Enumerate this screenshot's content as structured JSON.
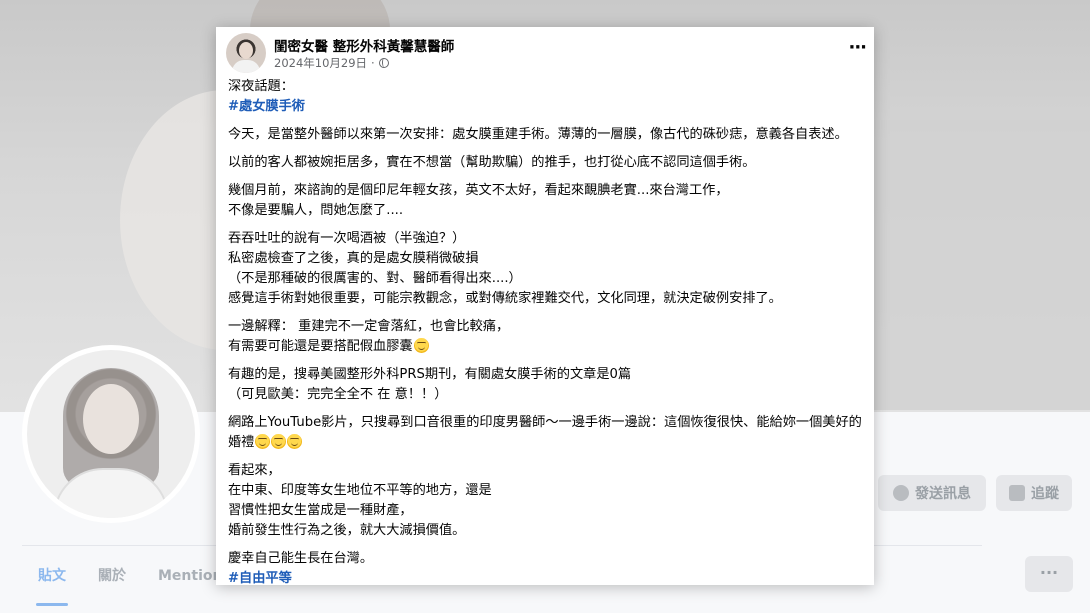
{
  "background": {
    "buttons": {
      "message": "發送訊息",
      "follow": "追蹤",
      "more": "···"
    },
    "tabs": [
      "貼文",
      "關於",
      "Mention"
    ]
  },
  "post": {
    "author": "閨密女醫 整形外科黃馨慧醫師",
    "date": "2024年10月29日",
    "meta_sep": "·",
    "more": "···",
    "hashtag_top": "#處女膜手術",
    "hashtag_bottom": "#自由平等",
    "paragraphs": {
      "p1": [
        "深夜話題："
      ],
      "p2": [
        "今天，是當整外醫師以來第一次安排：處女膜重建手術。薄薄的一層膜，像古代的硃砂痣，意義各自表述。"
      ],
      "p3": [
        "以前的客人都被婉拒居多，實在不想當（幫助欺騙）的推手，也打從心底不認同這個手術。"
      ],
      "p4": [
        "幾個月前，來諮詢的是個印尼年輕女孩，英文不太好，看起來靦腆老實...來台灣工作，",
        "不像是要騙人，問她怎麼了...."
      ],
      "p5": [
        "吞吞吐吐的說有一次喝酒被（半強迫？）",
        "私密處檢查了之後，真的是處女膜稍微破損",
        "（不是那種破的很厲害的、對、醫師看得出來....）",
        "感覺這手術對她很重要，可能宗教觀念，或對傳統家裡難交代，文化同理，就決定破例安排了。"
      ],
      "p6": [
        "一邊解釋： 重建完不一定會落紅，也會比較痛，",
        "有需要可能還是要搭配假血膠囊"
      ],
      "p7": [
        "有趣的是，搜尋美國整形外科PRS期刊，有關處女膜手術的文章是0篇",
        "（可見歐美：完完全全不 在 意！！）"
      ],
      "p8": [
        "網路上YouTube影片，只搜尋到口音很重的印度男醫師～一邊手術一邊說：這個恢復很快、能給妳一個美好的婚禮"
      ],
      "p9": [
        "看起來，",
        "在中東、印度等女生地位不平等的地方，還是",
        "習慣性把女生當成是一種財產，",
        "婚前發生性行為之後，就大大減損價值。"
      ],
      "p10": [
        "慶幸自己能生長在台灣。"
      ]
    }
  }
}
